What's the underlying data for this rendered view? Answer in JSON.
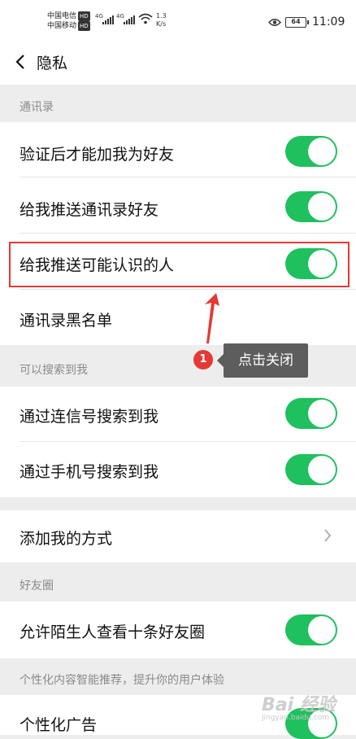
{
  "status_bar": {
    "carrier1": "中国电信",
    "carrier2": "中国移动",
    "hd_badge": "HD",
    "network1": "4G",
    "network2": "4G",
    "speed_value": "1.3",
    "speed_unit": "K/s",
    "battery": "64",
    "time": "11:09",
    "icons": [
      "signal-icon",
      "wifi-icon",
      "eye-icon",
      "battery-icon"
    ]
  },
  "nav": {
    "title": "隐私",
    "back_icon": "chevron-left-icon"
  },
  "sections": {
    "contacts": "通讯录",
    "search": "可以搜索到我",
    "moments": "好友圈",
    "personalize": "个性化内容智能推荐，提升你的用户体验"
  },
  "rows": {
    "verify_friend": {
      "label": "验证后才能加我为好友",
      "on": true
    },
    "push_contacts": {
      "label": "给我推送通讯录好友",
      "on": true
    },
    "push_may_know": {
      "label": "给我推送可能认识的人",
      "on": true
    },
    "blacklist": {
      "label": "通讯录黑名单"
    },
    "search_by_id": {
      "label": "通过连信号搜索到我",
      "on": true
    },
    "search_by_phone": {
      "label": "通过手机号搜索到我",
      "on": true
    },
    "add_methods": {
      "label": "添加我的方式"
    },
    "stranger_moments": {
      "label": "允许陌生人查看十条好友圈",
      "on": true
    },
    "personal_ads": {
      "label": "个性化广告",
      "on": true
    }
  },
  "annotation": {
    "step_number": "1",
    "tooltip": "点击关闭",
    "highlight_color": "#e53935"
  },
  "colors": {
    "toggle_on": "#1fc05e",
    "background": "#ededed"
  },
  "watermark": {
    "main": "Bai 经验",
    "sub": "jingyan.baidu.com"
  }
}
